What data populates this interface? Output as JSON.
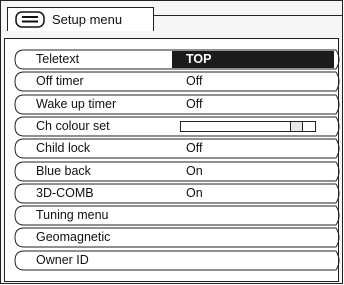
{
  "header": {
    "title": "Setup menu",
    "icon": "tv-screen-icon"
  },
  "menu": [
    {
      "label": "Teletext",
      "value": "TOP",
      "selected": true
    },
    {
      "label": "Off timer",
      "value": "Off"
    },
    {
      "label": "Wake up timer",
      "value": "Off"
    },
    {
      "label": "Ch colour set",
      "value": "",
      "slider_level": 0.9
    },
    {
      "label": "Child lock",
      "value": "Off"
    },
    {
      "label": "Blue back",
      "value": "On"
    },
    {
      "label": "3D-COMB",
      "value": "On"
    },
    {
      "label": "Tuning menu",
      "value": ""
    },
    {
      "label": "Geomagnetic",
      "value": ""
    },
    {
      "label": "Owner ID",
      "value": ""
    }
  ]
}
